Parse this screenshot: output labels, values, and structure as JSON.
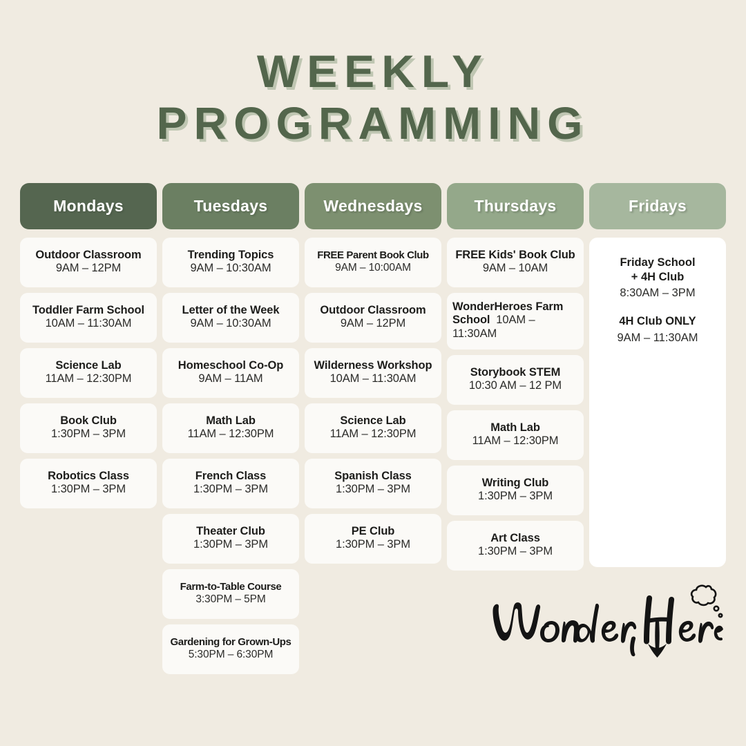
{
  "header": {
    "title_line_1": "WEEKLY",
    "title_line_2": "PROGRAMMING"
  },
  "colors": {
    "background": "#f0ebe1",
    "title_green": "#53664c",
    "title_shadow": "#97a88d",
    "card_fill": "#fbfaf7",
    "friday_card_fill": "#ffffff",
    "text_dark": "#1d1d1b",
    "header_monday": "#556650",
    "header_tuesday": "#6b7f62",
    "header_wednesday": "#7d9070",
    "header_thursday": "#94a88a",
    "header_friday": "#a6b79e"
  },
  "columns": [
    {
      "day": "Mondays",
      "header_color": "#556650",
      "events": [
        {
          "title": "Outdoor Classroom",
          "time": "9AM – 12PM"
        },
        {
          "title": "Toddler Farm School",
          "time": "10AM – 11:30AM"
        },
        {
          "title": "Science Lab",
          "time": "11AM – 12:30PM"
        },
        {
          "title": "Book Club",
          "time": "1:30PM – 3PM"
        },
        {
          "title": "Robotics Class",
          "time": "1:30PM – 3PM"
        }
      ]
    },
    {
      "day": "Tuesdays",
      "header_color": "#6b7f62",
      "events": [
        {
          "title": "Trending Topics",
          "time": "9AM – 10:30AM"
        },
        {
          "title": "Letter of the Week",
          "time": "9AM – 10:30AM"
        },
        {
          "title": "Homeschool Co-Op",
          "time": "9AM – 11AM"
        },
        {
          "title": "Math Lab",
          "time": "11AM – 12:30PM"
        },
        {
          "title": "French Class",
          "time": "1:30PM – 3PM"
        },
        {
          "title": "Theater Club",
          "time": "1:30PM – 3PM"
        },
        {
          "title": "Farm-to-Table Course",
          "time": "3:30PM – 5PM"
        },
        {
          "title": "Gardening for Grown-Ups",
          "time": "5:30PM – 6:30PM"
        }
      ]
    },
    {
      "day": "Wednesdays",
      "header_color": "#7d9070",
      "events": [
        {
          "title": "FREE Parent Book Club",
          "time": "9AM – 10:00AM"
        },
        {
          "title": "Outdoor Classroom",
          "time": "9AM – 12PM"
        },
        {
          "title": "Wilderness Workshop",
          "time": "10AM – 11:30AM"
        },
        {
          "title": "Science Lab",
          "time": "11AM – 12:30PM"
        },
        {
          "title": "Spanish Class",
          "time": "1:30PM – 3PM"
        },
        {
          "title": "PE Club",
          "time": "1:30PM – 3PM"
        }
      ]
    },
    {
      "day": "Thursdays",
      "header_color": "#94a88a",
      "events": [
        {
          "title": "FREE Kids' Book Club",
          "time": "9AM – 10AM"
        },
        {
          "title": "WonderHeroes Farm School",
          "time": "10AM – 11:30AM"
        },
        {
          "title": "Storybook STEM",
          "time": "10:30 AM – 12 PM"
        },
        {
          "title": "Math Lab",
          "time": "11AM – 12:30PM"
        },
        {
          "title": "Writing Club",
          "time": "1:30PM – 3PM"
        },
        {
          "title": "Art Class",
          "time": "1:30PM – 3PM"
        }
      ]
    },
    {
      "day": "Fridays",
      "header_color": "#a6b79e",
      "events": [
        {
          "title": "Friday School\n+ 4H Club",
          "time": "8:30AM – 3PM"
        },
        {
          "title": "4H Club ONLY",
          "time": "9AM – 11:30AM"
        }
      ]
    }
  ],
  "logo": {
    "wordmark": "WonderHere",
    "icons": [
      "thought-bubble-icon",
      "down-arrow-icon"
    ]
  }
}
